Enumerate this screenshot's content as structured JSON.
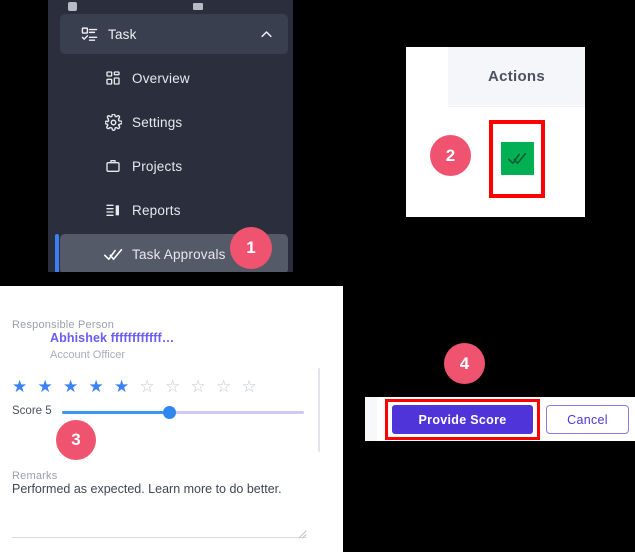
{
  "sidebar": {
    "group": {
      "label": "Task",
      "icon": "task-list-icon",
      "chevron": "chevron-up-icon"
    },
    "items": [
      {
        "label": "Overview",
        "icon": "grid-icon"
      },
      {
        "label": "Settings",
        "icon": "gear-icon"
      },
      {
        "label": "Projects",
        "icon": "briefcase-icon"
      },
      {
        "label": "Reports",
        "icon": "report-bars-icon"
      },
      {
        "label": "Task Approvals",
        "icon": "double-check-icon",
        "active": true
      }
    ]
  },
  "actions_card": {
    "header": "Actions",
    "approve_icon": "double-check-approve-icon",
    "approve_color": "#00b053",
    "highlight_color": "#ff0000"
  },
  "form": {
    "responsible_person_label": "Responsible Person",
    "responsible_person_name": "Abhishek ffffffffffff…",
    "responsible_person_role": "Account Officer",
    "rating": {
      "filled": 5,
      "total": 10,
      "filled_color": "#3b82f6",
      "empty_color": "#c3c8d1"
    },
    "score_label": "Score 5",
    "score_value": 5,
    "score_min": 0,
    "score_max": 10,
    "remarks_label": "Remarks",
    "remarks_value": "Performed as expected. Learn more to do better."
  },
  "footer": {
    "primary_label": "Provide Score",
    "primary_color": "#4f35d9",
    "secondary_label": "Cancel",
    "highlight_color": "#ff0000"
  },
  "badges": {
    "one": "1",
    "two": "2",
    "three": "3",
    "four": "4",
    "color": "#ef5370"
  }
}
